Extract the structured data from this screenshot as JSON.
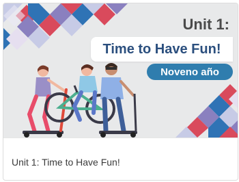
{
  "card": {
    "unit_label": "Unit 1:",
    "banner_title": "Time to Have Fun!",
    "grade_badge": "Noveno año",
    "course_name": "Unit 1: Time to Have Fun!"
  },
  "illustration": {
    "description_icon": "people-with-scooters-and-bicycle-illustration"
  },
  "colors": {
    "banner_bg": "#e8e9ea",
    "title_text": "#2b4f7e",
    "badge_bg": "#2f7dae",
    "diamond_red": "#d94a5c",
    "diamond_blue": "#2f73b5",
    "diamond_purple": "#8a80bf"
  }
}
